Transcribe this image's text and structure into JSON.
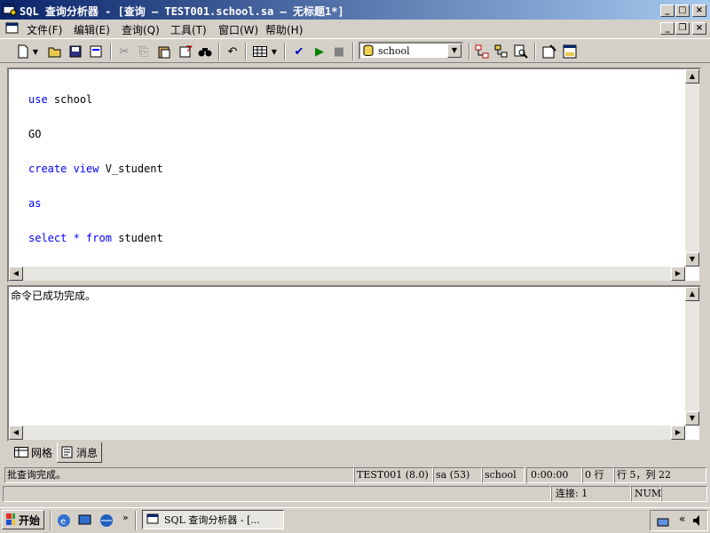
{
  "window": {
    "title": "SQL 查询分析器 - [查询 — TEST001.school.sa — 无标题1*]"
  },
  "menu": [
    "文件(F)",
    "编辑(E)",
    "查询(Q)",
    "工具(T)",
    "窗口(W)",
    "帮助(H)"
  ],
  "toolbar": {
    "database": "school"
  },
  "editor": {
    "lines": [
      "use school",
      "GO",
      "create view V_student",
      "as",
      "select * from student"
    ]
  },
  "results": {
    "message": "命令已成功完成。"
  },
  "tabs": {
    "grid": "网格",
    "messages": "消息"
  },
  "status": {
    "text": "批查询完成。",
    "server": "TEST001 (8.0)",
    "user": "sa (53)",
    "db": "school",
    "time": "0:00:00",
    "rows": "0 行",
    "position": "行 5，列 22",
    "connections": "连接: 1",
    "num": "NUM"
  },
  "taskbar": {
    "start": "开始",
    "window_title": "SQL 查询分析器 - [..."
  },
  "colors": {
    "titlebar": "#0a246a",
    "keyword": "#0000ff"
  }
}
